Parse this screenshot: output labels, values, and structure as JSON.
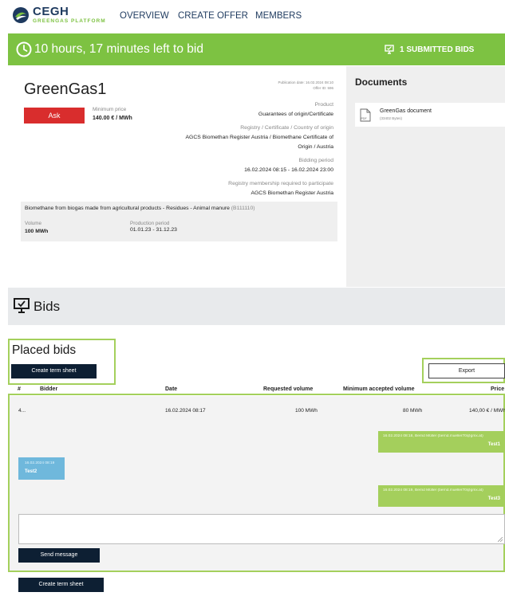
{
  "header": {
    "logo": "CEGH",
    "logo_sub": "GREENGAS PLATFORM",
    "nav": [
      "OVERVIEW",
      "CREATE OFFER",
      "MEMBERS"
    ]
  },
  "banner": {
    "time_left": "10 hours, 17 minutes left to bid",
    "submitted": "1 SUBMITTED BIDS",
    "color": "#7dc242"
  },
  "offer": {
    "title": "GreenGas1",
    "ask_label": "Ask",
    "min_price_label": "Minimum price",
    "min_price_value": "140.00 € / MWh",
    "publication_date": "Publication date: 16.02.2024 08:10",
    "offer_id": "Offer ID: 596",
    "product_label": "Product",
    "product_value": "Guarantees of origin/Certificate",
    "registry_label": "Registry / Certificate / Country of origin",
    "registry_line1": "AGCS Biomethan Register Austria / Biomethane Certificate of",
    "registry_line2": "Origin / Austria",
    "bidding_label": "Bidding period",
    "bidding_value": "16.02.2024 08:15 - 16.02.2024 23:00",
    "membership_label": "Registry membership required to participate",
    "membership_value": "AGCS Biomethan Register Austria",
    "description": "Biomethane from biogas made from agricultural products - Residues - Animal manure",
    "description_code": "(B111110)",
    "volume_label": "Volume",
    "volume_value": "100 MWh",
    "production_label": "Production period",
    "production_value": "01.01.23 - 31.12.23"
  },
  "documents": {
    "title": "Documents",
    "items": [
      {
        "name": "GreenGas document",
        "size": "(33402 Bytes)",
        "icon_label": "PDF"
      }
    ]
  },
  "bids_section": {
    "title": "Bids",
    "placed_title": "Placed bids",
    "create_term_sheet": "Create term sheet",
    "export": "Export",
    "columns": [
      "#",
      "Bidder",
      "Date",
      "Requested volume",
      "Minimum accepted volume",
      "Price"
    ],
    "rows": [
      {
        "num": "4...",
        "bidder": "",
        "date": "16.02.2024 08:17",
        "requested": "100 MWh",
        "minimum": "80 MWh",
        "price": "140,00 € / MWh"
      }
    ],
    "messages": [
      {
        "side": "right",
        "meta": "16.02.2024 08:18, Bernd Müller (bernd.mueller70@gmx.at)",
        "text": "Test1"
      },
      {
        "side": "left",
        "meta": "16.02.2024 08:19",
        "text": "Test2"
      },
      {
        "side": "right",
        "meta": "16.02.2024 08:19, Bernd Müller (bernd.mueller70@gmx.at)",
        "text": "Test3"
      }
    ],
    "send_message": "Send message",
    "create_term_sheet_bottom": "Create term sheet"
  }
}
